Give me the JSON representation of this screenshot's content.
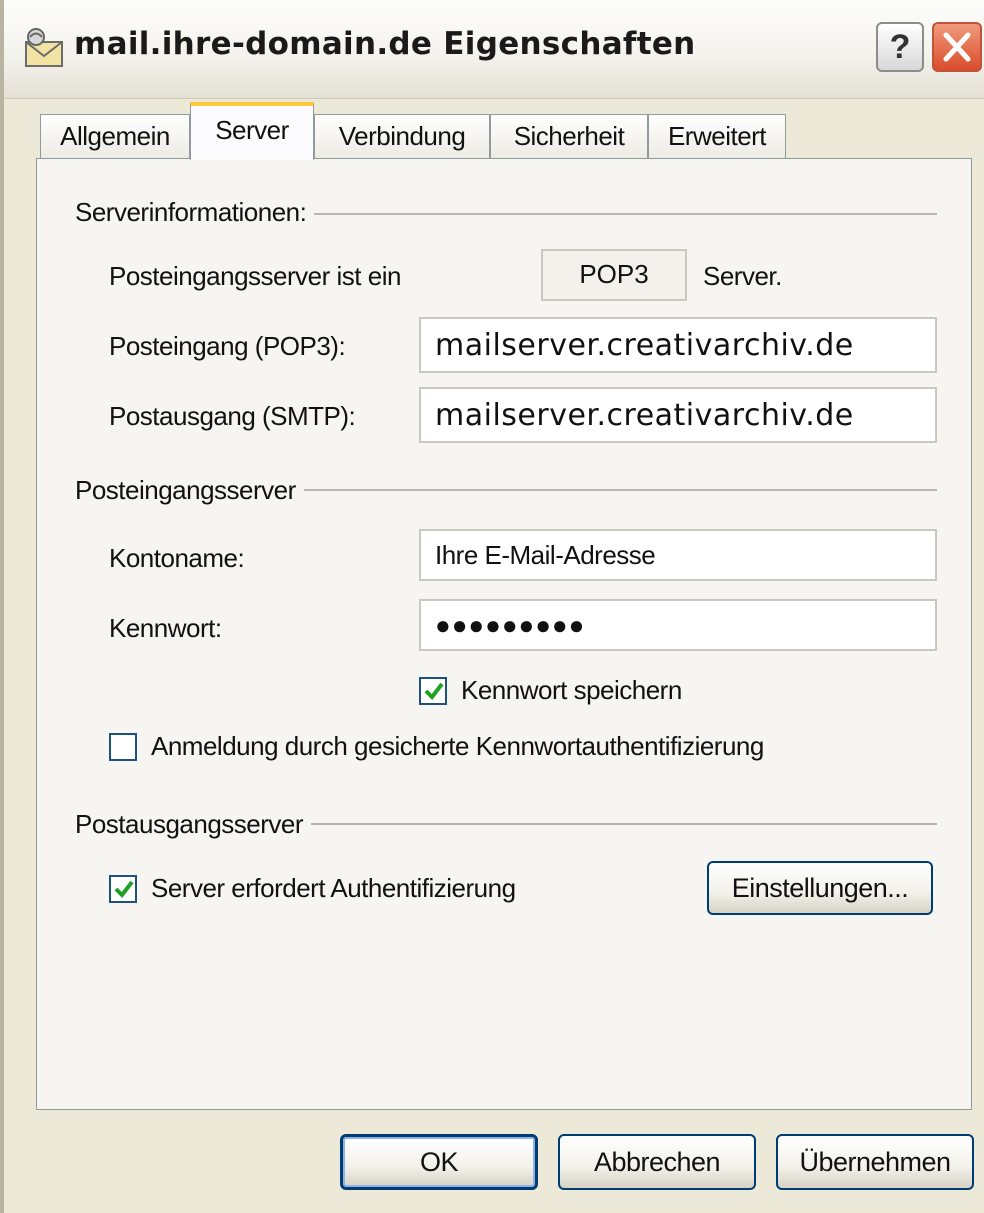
{
  "window": {
    "title": "mail.ihre-domain.de Eigenschaften",
    "help_glyph": "?"
  },
  "tabs": [
    {
      "label": "Allgemein",
      "active": false
    },
    {
      "label": "Server",
      "active": true
    },
    {
      "label": "Verbindung",
      "active": false
    },
    {
      "label": "Sicherheit",
      "active": false
    },
    {
      "label": "Erweitert",
      "active": false
    }
  ],
  "server_info": {
    "group_title": "Serverinformationen:",
    "incoming_type_label": "Posteingangsserver ist ein",
    "incoming_type_value": "POP3",
    "incoming_type_suffix": "Server.",
    "incoming_label": "Posteingang (POP3):",
    "incoming_value": "mailserver.creativarchiv.de",
    "outgoing_label": "Postausgang (SMTP):",
    "outgoing_value": "mailserver.creativarchiv.de"
  },
  "incoming_server": {
    "group_title": "Posteingangsserver",
    "account_label": "Kontoname:",
    "account_value": "Ihre E-Mail-Adresse",
    "password_label": "Kennwort:",
    "password_value": "●●●●●●●●●",
    "remember_password_label": "Kennwort speichern",
    "remember_password_checked": true,
    "spa_label": "Anmeldung durch gesicherte Kennwortauthentifizierung",
    "spa_checked": false
  },
  "outgoing_server": {
    "group_title": "Postausgangsserver",
    "auth_required_label": "Server erfordert Authentifizierung",
    "auth_required_checked": true,
    "settings_button": "Einstellungen..."
  },
  "footer": {
    "ok": "OK",
    "cancel": "Abbrechen",
    "apply": "Übernehmen"
  },
  "colors": {
    "accent_tab": "#ffc83c",
    "close_button": "#d94d2a",
    "checkmark": "#21a121",
    "button_border": "#003c74"
  }
}
